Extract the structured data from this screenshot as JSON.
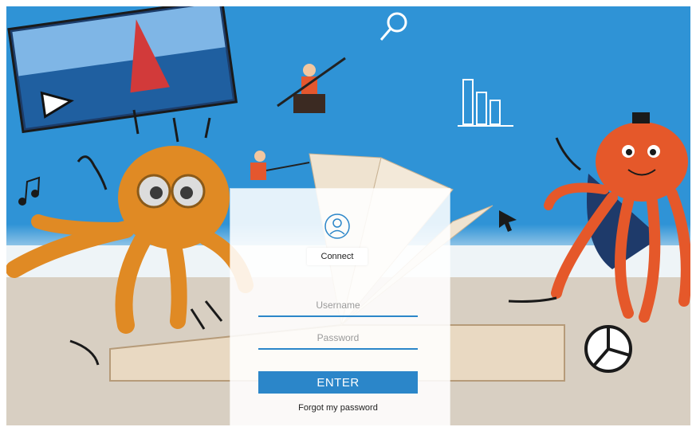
{
  "login": {
    "connect_label": "Connect",
    "username_placeholder": "Username",
    "password_placeholder": "Password",
    "enter_label": "ENTER",
    "forgot_label": "Forgot my password"
  },
  "colors": {
    "sky": "#2f93d6",
    "accent": "#2b86c9",
    "octopus_left": "#e08a24",
    "octopus_right": "#e5582a"
  },
  "icons": [
    "play-icon",
    "magnifier-icon",
    "music-note-icon",
    "bar-chart-icon",
    "pie-chart-icon",
    "cursor-arrow-icon",
    "user-icon"
  ]
}
